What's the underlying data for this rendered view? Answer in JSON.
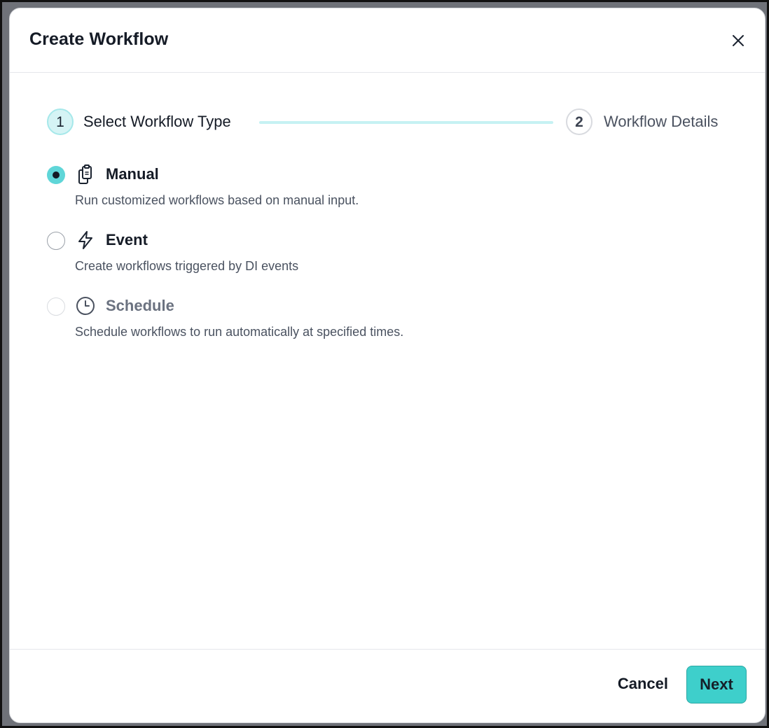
{
  "dialog": {
    "title": "Create Workflow",
    "close_icon": "close-icon"
  },
  "stepper": {
    "steps": [
      {
        "number": "1",
        "label": "Select Workflow Type",
        "state": "active"
      },
      {
        "number": "2",
        "label": "Workflow Details",
        "state": "pending"
      }
    ]
  },
  "options": [
    {
      "label": "Manual",
      "description": "Run customized workflows based on manual input.",
      "icon": "clipboard-copy-icon",
      "selected": true,
      "disabled": false
    },
    {
      "label": "Event",
      "description": "Create workflows triggered by DI events",
      "icon": "lightning-bolt-icon",
      "selected": false,
      "disabled": false
    },
    {
      "label": "Schedule",
      "description": "Schedule workflows to run automatically at specified times.",
      "icon": "clock-icon",
      "selected": false,
      "disabled": true
    }
  ],
  "footer": {
    "cancel_label": "Cancel",
    "next_label": "Next"
  },
  "colors": {
    "accent": "#3ecfcb",
    "accent_light": "#d5f4f5",
    "text_primary": "#151b26",
    "text_secondary": "#4a5260"
  }
}
